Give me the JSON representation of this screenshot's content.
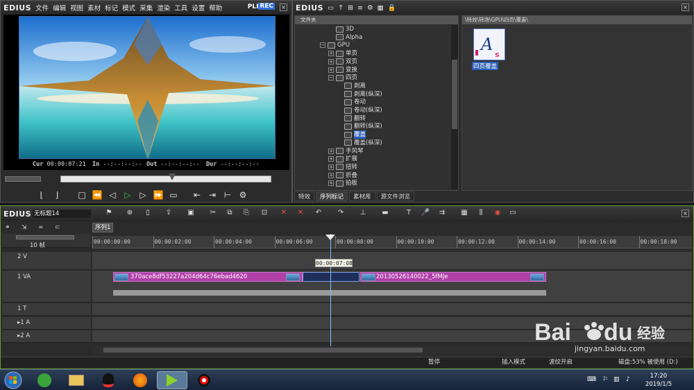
{
  "player": {
    "brand": "EDIUS",
    "menu": [
      "文件",
      "编辑",
      "视图",
      "素材",
      "标记",
      "模式",
      "采集",
      "渲染",
      "工具",
      "设置",
      "帮助"
    ],
    "plr": "PLR",
    "rec": "REC",
    "cur_label": "Cur",
    "cur_value": "00:00:07:21",
    "in_label": "In",
    "in_value": "--:--:--:--",
    "out_label": "Out",
    "out_value": "--:--:--:--",
    "dur_label": "Dur",
    "dur_value": "--:--:--:--"
  },
  "bin": {
    "brand": "EDIUS",
    "tree_title": "文件夹",
    "path": "\\特效\\转场\\GPU\\四页\\覆盖\\",
    "tree": [
      {
        "label": "3D",
        "indent": 1,
        "expander": ""
      },
      {
        "label": "Alpha",
        "indent": 1,
        "expander": ""
      },
      {
        "label": "GPU",
        "indent": 0,
        "expander": "−"
      },
      {
        "label": "单页",
        "indent": 1,
        "expander": "+"
      },
      {
        "label": "双页",
        "indent": 1,
        "expander": "+"
      },
      {
        "label": "变换",
        "indent": 1,
        "expander": "+"
      },
      {
        "label": "四页",
        "indent": 1,
        "expander": "−"
      },
      {
        "label": "剥离",
        "indent": 2,
        "expander": ""
      },
      {
        "label": "剥离(纵深)",
        "indent": 2,
        "expander": ""
      },
      {
        "label": "卷动",
        "indent": 2,
        "expander": ""
      },
      {
        "label": "卷动(纵深)",
        "indent": 2,
        "expander": ""
      },
      {
        "label": "翻转",
        "indent": 2,
        "expander": ""
      },
      {
        "label": "翻转(纵深)",
        "indent": 2,
        "expander": ""
      },
      {
        "label": "覆盖",
        "indent": 2,
        "expander": "",
        "selected": true
      },
      {
        "label": "覆盖(纵深)",
        "indent": 2,
        "expander": ""
      },
      {
        "label": "手风琴",
        "indent": 1,
        "expander": "+"
      },
      {
        "label": "扩展",
        "indent": 1,
        "expander": "+"
      },
      {
        "label": "扭转",
        "indent": 1,
        "expander": "+"
      },
      {
        "label": "折叠",
        "indent": 1,
        "expander": "+"
      },
      {
        "label": "拍板",
        "indent": 1,
        "expander": "+"
      }
    ],
    "effect_item": {
      "label": "四页覆盖",
      "icon_text": "As"
    },
    "tabs": [
      "特效",
      "序列标记",
      "素材库",
      "源文件浏览"
    ],
    "active_tab": "序列标记"
  },
  "timeline": {
    "brand": "EDIUS",
    "project_name": "无标题14",
    "sequence_tab": "序列1",
    "zoom_label": "10 帧",
    "ruler_ticks": [
      "00:00:00:00",
      "00:00:02:00",
      "00:00:04:00",
      "00:00:06:00",
      "00:00:08:00",
      "00:00:10:00",
      "00:00:12:00",
      "00:00:14:00",
      "00:00:16:00",
      "00:00:18:00"
    ],
    "tracks": [
      {
        "label": "2 V",
        "type": "video"
      },
      {
        "label": "1 VA",
        "type": "videoaudio"
      },
      {
        "label": "1 T",
        "type": "title"
      },
      {
        "label": "▸1 A",
        "type": "audio"
      },
      {
        "label": "▸2 A",
        "type": "audio"
      }
    ],
    "clip_a": "370ace8df53227a204d64c76ebad4620",
    "clip_b": "20130526140022_5fMJe",
    "tooltip": "00:00:07:08",
    "status": {
      "pause": "暂停",
      "insert_mode": "插入模式",
      "ripple": "波纹开启",
      "disk": "磁盘:53% 被使用 (D:)"
    }
  },
  "taskbar": {
    "time": "17:20",
    "date": "2019/1/5"
  },
  "watermark": {
    "brand": "Baidu经验",
    "url": "jingyan.baidu.com"
  },
  "colors": {
    "clip": "#b040a8",
    "playhead": "#7fbfff",
    "selection": "#2d5fb8",
    "play_button": "#2ecc40",
    "rec_badge": "#2f6fd8"
  }
}
